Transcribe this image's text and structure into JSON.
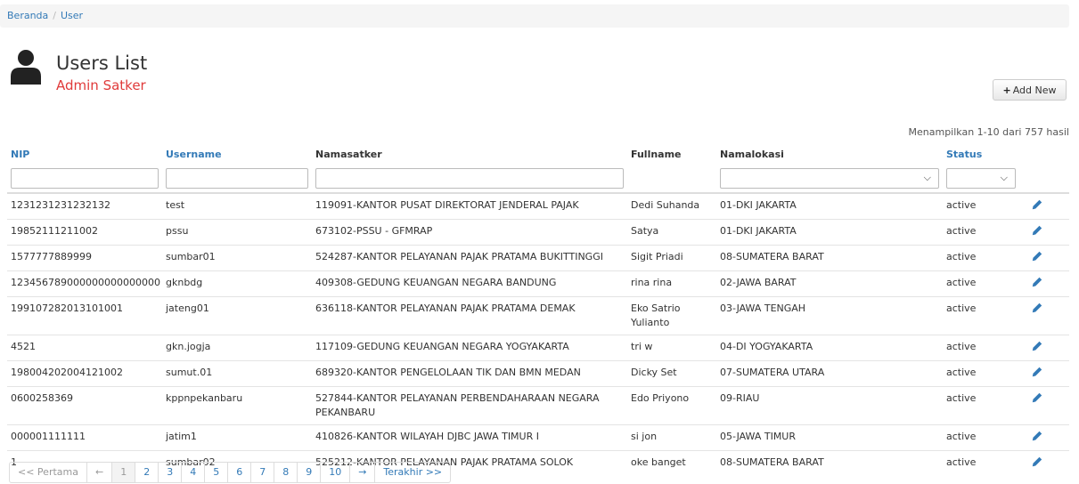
{
  "breadcrumb": {
    "home": "Beranda",
    "separator": "/",
    "current": "User"
  },
  "header": {
    "title": "Users List",
    "subtitle": "Admin Satker",
    "add_label": "Add New",
    "add_icon": "+"
  },
  "summary": "Menampilkan 1-10 dari 757 hasil",
  "columns": {
    "nip": "NIP",
    "username": "Username",
    "namasatker": "Namasatker",
    "fullname": "Fullname",
    "namalokasi": "Namalokasi",
    "status": "Status"
  },
  "filters": {
    "nip": "",
    "username": "",
    "namasatker": "",
    "namalokasi": "",
    "status": ""
  },
  "rows": [
    {
      "nip": "1231231231232132",
      "username": "test",
      "namasatker": "119091-KANTOR PUSAT DIREKTORAT JENDERAL PAJAK",
      "fullname": "Dedi Suhanda",
      "namalokasi": "01-DKI JAKARTA",
      "status": "active"
    },
    {
      "nip": "19852111211002",
      "username": "pssu",
      "namasatker": "673102-PSSU - GFMRAP",
      "fullname": "Satya",
      "namalokasi": "01-DKI JAKARTA",
      "status": "active"
    },
    {
      "nip": "1577777889999",
      "username": "sumbar01",
      "namasatker": "524287-KANTOR PELAYANAN PAJAK PRATAMA BUKITTINGGI",
      "fullname": "Sigit Priadi",
      "namalokasi": "08-SUMATERA BARAT",
      "status": "active"
    },
    {
      "nip": "123456789000000000000000",
      "username": "gknbdg",
      "namasatker": "409308-GEDUNG KEUANGAN NEGARA BANDUNG",
      "fullname": "rina rina",
      "namalokasi": "02-JAWA BARAT",
      "status": "active"
    },
    {
      "nip": "199107282013101001",
      "username": "jateng01",
      "namasatker": "636118-KANTOR PELAYANAN PAJAK PRATAMA DEMAK",
      "fullname": "Eko Satrio Yulianto",
      "namalokasi": "03-JAWA TENGAH",
      "status": "active"
    },
    {
      "nip": "4521",
      "username": "gkn.jogja",
      "namasatker": "117109-GEDUNG KEUANGAN NEGARA YOGYAKARTA",
      "fullname": "tri w",
      "namalokasi": "04-DI YOGYAKARTA",
      "status": "active"
    },
    {
      "nip": "198004202004121002",
      "username": "sumut.01",
      "namasatker": "689320-KANTOR PENGELOLAAN TIK DAN BMN MEDAN",
      "fullname": "Dicky Set",
      "namalokasi": "07-SUMATERA UTARA",
      "status": "active"
    },
    {
      "nip": "0600258369",
      "username": "kppnpekanbaru",
      "namasatker": "527844-KANTOR PELAYANAN PERBENDAHARAAN NEGARA PEKANBARU",
      "fullname": "Edo Priyono",
      "namalokasi": "09-RIAU",
      "status": "active"
    },
    {
      "nip": "000001111111",
      "username": "jatim1",
      "namasatker": "410826-KANTOR WILAYAH DJBC JAWA TIMUR I",
      "fullname": "si jon",
      "namalokasi": "05-JAWA TIMUR",
      "status": "active"
    },
    {
      "nip": "1",
      "username": "sumbar02",
      "namasatker": "525212-KANTOR PELAYANAN PAJAK PRATAMA SOLOK",
      "fullname": "oke banget",
      "namalokasi": "08-SUMATERA BARAT",
      "status": "active"
    }
  ],
  "pagination": {
    "first": "<< Pertama",
    "prev": "←",
    "pages": [
      "1",
      "2",
      "3",
      "4",
      "5",
      "6",
      "7",
      "8",
      "9",
      "10"
    ],
    "next": "→",
    "last": "Terakhir >>",
    "current": "1"
  },
  "colors": {
    "link": "#337ab7",
    "subtitle": "#e03a3a"
  },
  "icons": {
    "user": "user-icon",
    "edit": "pencil-icon",
    "add": "plus-icon",
    "dropdown": "chevron-down-icon"
  }
}
